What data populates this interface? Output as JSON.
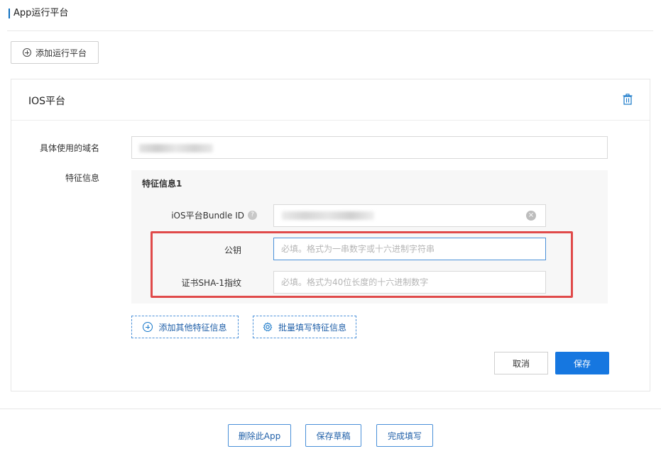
{
  "page": {
    "title": "App运行平台"
  },
  "toolbar": {
    "add_platform_label": "添加运行平台"
  },
  "card": {
    "title": "IOS平台",
    "domain_label": "具体使用的域名",
    "feature_label": "特征信息"
  },
  "feature": {
    "title": "特征信息1",
    "bundle_label": "iOS平台Bundle ID",
    "help_glyph": "?",
    "clear_glyph": "×",
    "pubkey_label": "公钥",
    "pubkey_placeholder": "必填。格式为一串数字或十六进制字符串",
    "sha_label": "证书SHA-1指纹",
    "sha_placeholder": "必填。格式为40位长度的十六进制数字"
  },
  "actions": {
    "add_feature_label": "添加其他特征信息",
    "batch_fill_label": "批量填写特征信息",
    "cancel_label": "取消",
    "save_label": "保存"
  },
  "footer": {
    "delete_app_label": "删除此App",
    "save_draft_label": "保存草稿",
    "finish_label": "完成填写"
  },
  "colors": {
    "accent": "#1677e0",
    "highlight": "#e04a4a"
  }
}
